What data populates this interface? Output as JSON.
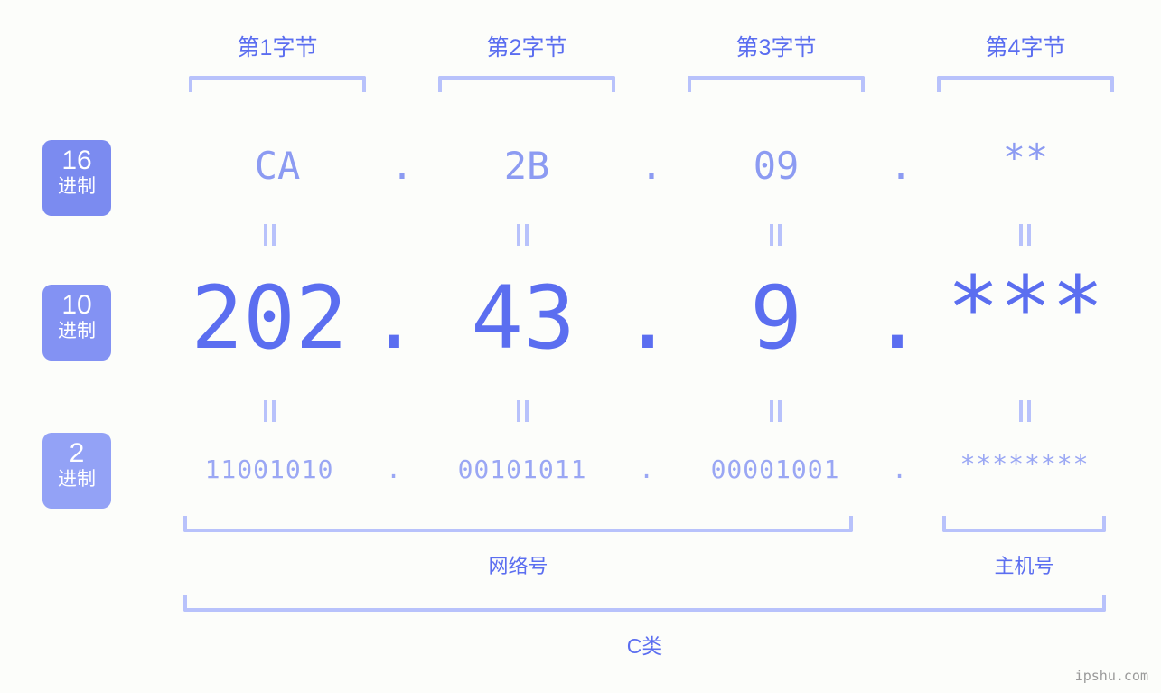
{
  "background_color": "#fcfdfa",
  "accent_colors": {
    "strong": "#5b6ef0",
    "medium": "#8c9bf2",
    "light": "#9aa7f4",
    "bracket": "#b8c2fb",
    "badge_hex": "#7b8bf0",
    "badge_dec": "#8392f3",
    "badge_bin": "#93a2f6",
    "watermark": "#9a9a9a"
  },
  "byte_headers": [
    {
      "label": "第1字节"
    },
    {
      "label": "第2字节"
    },
    {
      "label": "第3字节"
    },
    {
      "label": "第4字节"
    }
  ],
  "radix_badges": [
    {
      "number": "16",
      "unit": "进制"
    },
    {
      "number": "10",
      "unit": "进制"
    },
    {
      "number": "2",
      "unit": "进制"
    }
  ],
  "rows": {
    "hex": {
      "radix": "16",
      "values": [
        "CA",
        "2B",
        "09",
        "**"
      ],
      "separator": "."
    },
    "dec": {
      "radix": "10",
      "values": [
        "202",
        "43",
        "9",
        "***"
      ],
      "separator": "."
    },
    "bin": {
      "radix": "2",
      "values": [
        "11001010",
        "00101011",
        "00001001",
        "********"
      ],
      "separator": "."
    }
  },
  "equivalence_symbol": "=",
  "segments": [
    {
      "label": "网络号"
    },
    {
      "label": "主机号"
    }
  ],
  "class_label": "C类",
  "watermark": "ipshu.com"
}
